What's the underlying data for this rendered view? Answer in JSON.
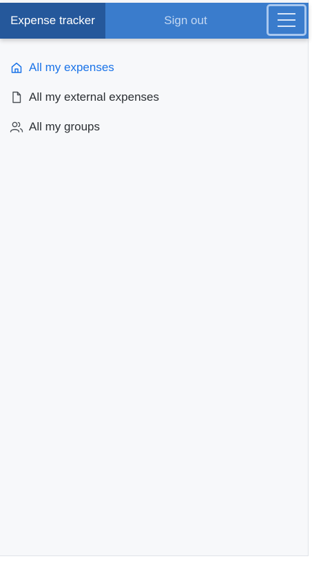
{
  "navbar": {
    "brand": "Expense tracker",
    "signout_label": "Sign out",
    "menu_icon": "hamburger-menu-icon"
  },
  "sidebar": {
    "items": [
      {
        "label": "All my expenses",
        "icon": "home-icon",
        "active": true,
        "color": "#1a73e8"
      },
      {
        "label": "All my external expenses",
        "icon": "file-icon",
        "active": false
      },
      {
        "label": "All my groups",
        "icon": "users-icon",
        "active": false
      }
    ]
  },
  "colors": {
    "navbar": "#3a7ccc",
    "brand_bg": "#25589b",
    "active_link": "#1a73e8",
    "page_bg": "#f7f8fa"
  }
}
